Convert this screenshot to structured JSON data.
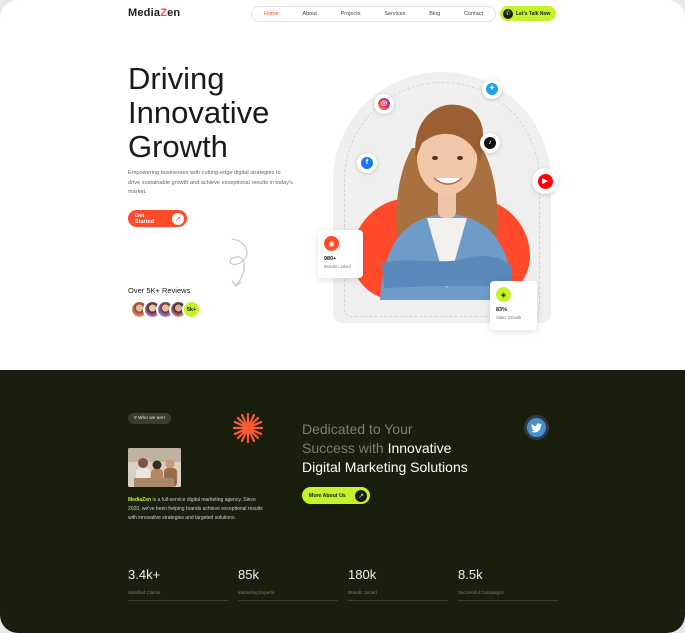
{
  "header": {
    "logo_prefix": "Media",
    "logo_accent": "Z",
    "logo_suffix": "en",
    "nav": [
      "Home",
      "About",
      "Projects",
      "Services",
      "Blog",
      "Contact"
    ],
    "active_nav": "Home",
    "cta_label": "Let's Talk Now"
  },
  "hero": {
    "title_lines": [
      "Driving",
      "Innovative",
      "Growth"
    ],
    "description": "Empowering businesses with cutting-edge digital strategies to drive sustainable growth and achieve exceptional results in today's market.",
    "cta_label": "Get Started",
    "reviews_label": "Over 5K+ Reviews",
    "reviews_badge": "5k+"
  },
  "cards": {
    "brands": {
      "number": "980+",
      "label": "Brands Linked"
    },
    "sales": {
      "number": "83%",
      "label": "Sales Growth"
    }
  },
  "about": {
    "tag": "# Who we are!",
    "brand": "MediaZen",
    "text": " is a full-service digital marketing agency. Since 2020, we've been helping brands achieve exceptional results with innovative strategies and targeted solutions.",
    "headline_muted_1": "Dedicated to Your",
    "headline_muted_2": "Success with ",
    "headline_hl_1": "Innovative",
    "headline_hl_2": "Digital Marketing Solutions",
    "cta_label": "More About Us"
  },
  "stats": [
    {
      "value": "3.4k+",
      "label": "Satisfied Clients"
    },
    {
      "value": "85k",
      "label": "Marketing Experts"
    },
    {
      "value": "180k",
      "label": "Brands Joined"
    },
    {
      "value": "8.5k",
      "label": "Successful Campaigns"
    }
  ],
  "colors": {
    "accent": "#ff4b2b",
    "lime": "#c4f22b",
    "dark": "#1a1e0c"
  }
}
